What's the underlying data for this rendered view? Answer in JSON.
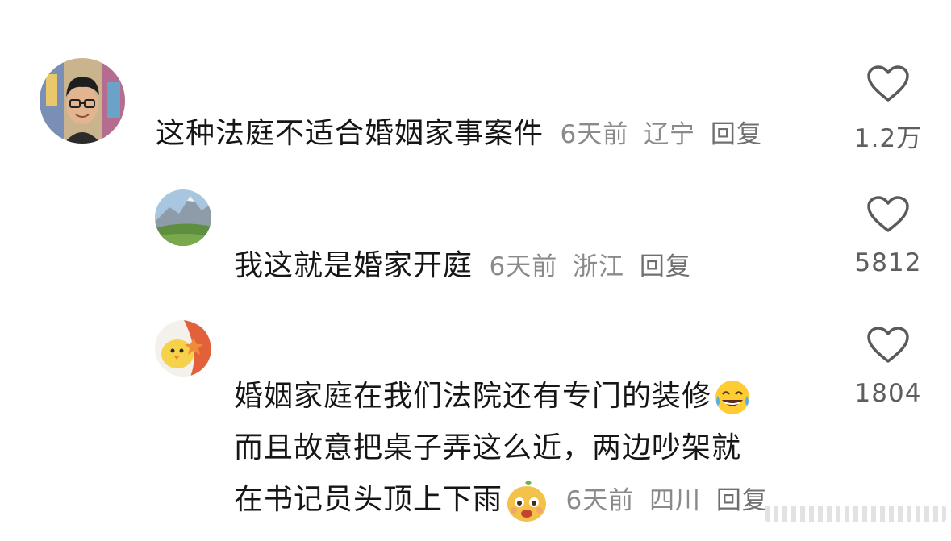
{
  "comments": [
    {
      "text": "这种法庭不适合婚姻家事案件",
      "time": "6天前",
      "location": "辽宁",
      "reply": "回复",
      "likes": "1.2万",
      "avatar_icon": "avatar-man-glasses"
    },
    {
      "text": "我这就是婚家开庭",
      "time": "6天前",
      "location": "浙江",
      "reply": "回复",
      "likes": "5812",
      "avatar_icon": "avatar-mountain-landscape"
    },
    {
      "lines": [
        "婚姻家庭在我们法院还有专门的装修",
        "而且故意把桌子弄这么近，两边吵架就",
        "在书记员头顶上下雨"
      ],
      "time": "6天前",
      "location": "四川",
      "reply": "回复",
      "likes": "1804",
      "avatar_icon": "avatar-cartoon-chick",
      "emojis": [
        "laughing-tears-emoji",
        "cartoon-face-emoji"
      ]
    }
  ],
  "colors": {
    "text": "#161616",
    "meta": "#8a8a8a",
    "like_icon": "#5a5a5a"
  }
}
